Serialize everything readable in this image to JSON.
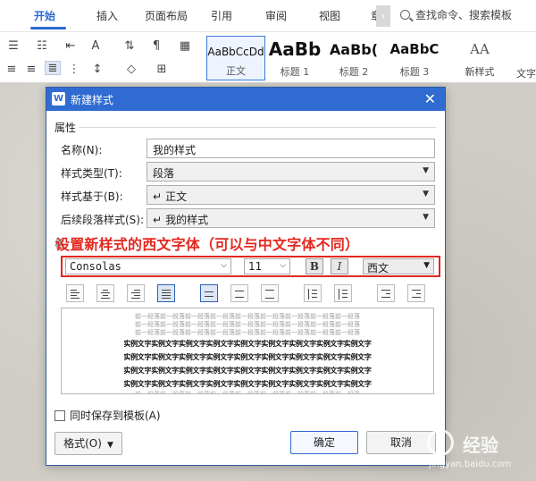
{
  "ribbon_tabs": [
    "开始",
    "插入",
    "页面布局",
    "引用",
    "审阅",
    "视图",
    "章"
  ],
  "search_placeholder": "查找命令、搜索模板",
  "styles": [
    {
      "preview": "AaBbCcDd",
      "label": "正文"
    },
    {
      "preview": "AaBb",
      "label": "标题 1"
    },
    {
      "preview": "AaBb(",
      "label": "标题 2"
    },
    {
      "preview": "AaBbC",
      "label": "标题 3"
    }
  ],
  "new_style_label": "新样式",
  "new_style_icon_text": "AA",
  "text_tool_label": "文字",
  "dialog": {
    "title": "新建样式",
    "section_properties": "属性",
    "name_label": "名称(N):",
    "name_value": "我的样式",
    "type_label": "样式类型(T):",
    "type_value": "段落",
    "based_label": "样式基于(B):",
    "based_value": "正文",
    "next_label": "后续段落样式(S):",
    "next_value": "我的样式",
    "format_section_partial": "格",
    "annotation": "设置新样式的西文字体（可以与中文字体不同）",
    "font_name": "Consolas",
    "font_size": "11",
    "bold_label": "B",
    "italic_label": "I",
    "script_value": "西文",
    "preview_prev_text": "前一段落前一段落前一段落前一段落前一段落前一段落前一段落前一段落前一段落",
    "preview_sample_text": "实例文字实例文字实例文字实例文字实例文字实例文字实例文字实例文字实例文字",
    "save_to_template": "同时保存到模板(A)",
    "format_button": "格式(O)",
    "ok_button": "确定",
    "cancel_button": "取消"
  },
  "watermark": {
    "text": "经验",
    "url": "jingyan.baidu.com"
  },
  "colors": {
    "accent": "#2a6ad3",
    "dialog_title": "#2f6bd0",
    "annotation": "#e3281f"
  }
}
